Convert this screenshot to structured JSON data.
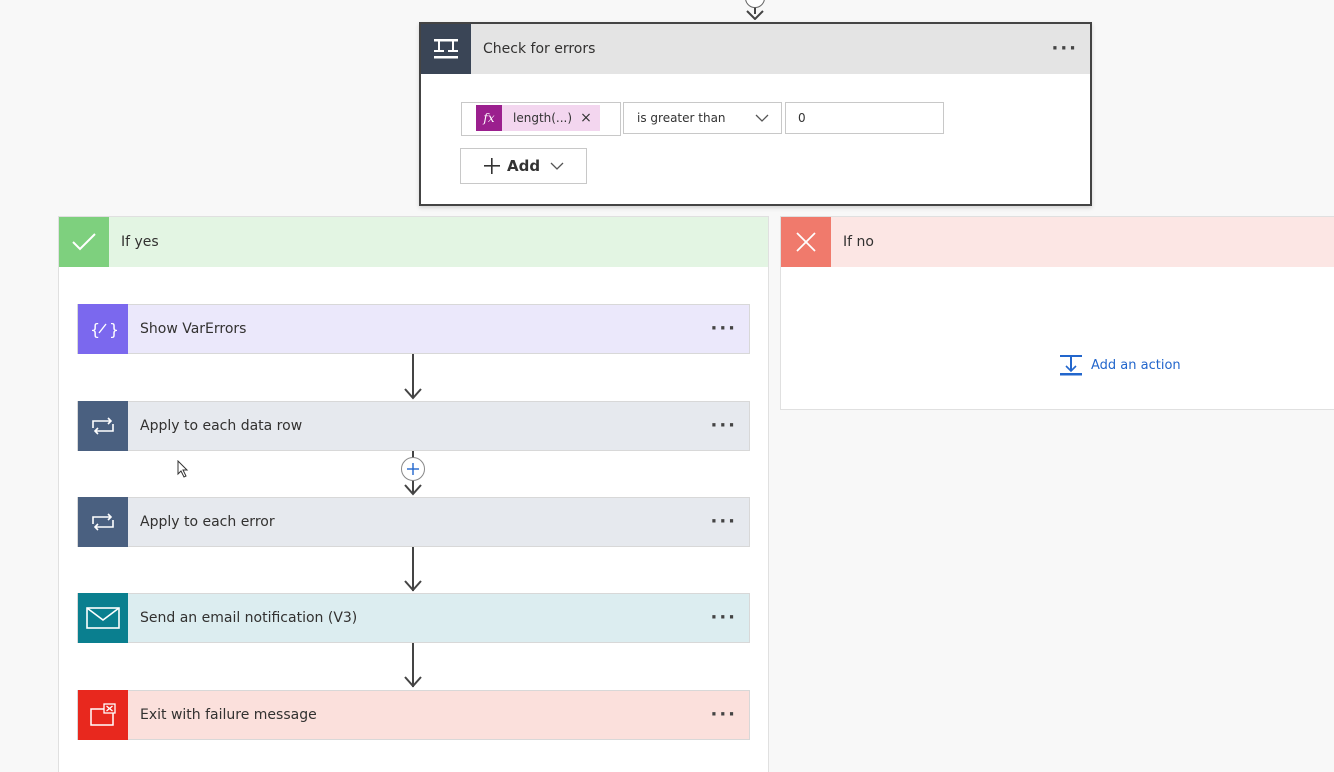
{
  "condition": {
    "title": "Check for errors",
    "expression_token": "length(...)",
    "token_remove": "×",
    "operator": "is greater than",
    "value": "0",
    "add_label": "Add"
  },
  "branches": {
    "yes_label": "If yes",
    "no_label": "If no",
    "add_action_label": "Add an action"
  },
  "actions": [
    {
      "label": "Show VarErrors",
      "color": "#7b68ee",
      "bg": "#ebe8fb"
    },
    {
      "label": "Apply to each data row",
      "color": "#4a6080",
      "bg": "#e6e9ee"
    },
    {
      "label": "Apply to each error",
      "color": "#4a6080",
      "bg": "#e6e9ee"
    },
    {
      "label": "Send an email notification (V3)",
      "color": "#0a7f8f",
      "bg": "#dcedf0"
    },
    {
      "label": "Exit with failure message",
      "color": "#e8281e",
      "bg": "#fbe0dc"
    }
  ],
  "more_menu": "···",
  "colors": {
    "condition_icon": "#3a4556",
    "yes_green": "#7ed07e",
    "no_red": "#f07a6c",
    "link_blue": "#2266cc",
    "token_purple": "#9b1f8e"
  }
}
